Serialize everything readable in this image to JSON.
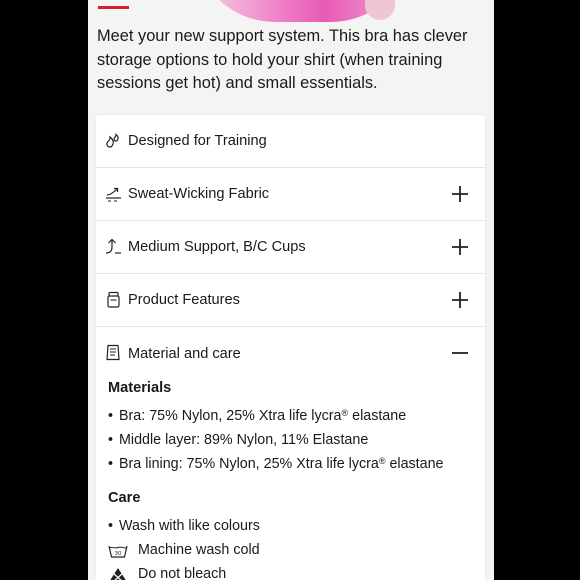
{
  "intro": "Meet your new support system. This bra has clever storage options to hold your shirt (when training sessions get hot) and small essentials.",
  "accordion": [
    {
      "label": "Designed for Training",
      "icon": "sparkle-drops-icon",
      "toggle": ""
    },
    {
      "label": "Sweat-Wicking Fabric",
      "icon": "wicking-icon",
      "toggle": "plus-icon"
    },
    {
      "label": "Medium Support, B/C Cups",
      "icon": "support-arrow-icon",
      "toggle": "plus-icon"
    },
    {
      "label": "Product Features",
      "icon": "layers-icon",
      "toggle": "plus-icon"
    },
    {
      "label": "Material and care",
      "icon": "care-label-icon",
      "toggle": "minus-icon"
    }
  ],
  "materials": {
    "heading": "Materials",
    "items": [
      {
        "text": "Bra: 75% Nylon, 25% Xtra life lycra",
        "sup": "®",
        "tail": " elastane"
      },
      {
        "text": "Middle layer: 89% Nylon, 11% Elastane",
        "sup": "",
        "tail": ""
      },
      {
        "text": "Bra lining: 75% Nylon, 25% Xtra life lycra",
        "sup": "®",
        "tail": " elastane"
      }
    ]
  },
  "care": {
    "heading": "Care",
    "bullet": "Wash with like colours",
    "instructions": [
      {
        "text": "Machine wash cold",
        "icon": "wash-30-icon"
      },
      {
        "text": "Do not bleach",
        "icon": "no-bleach-icon"
      }
    ]
  },
  "colors": {
    "accent": "#d6202f",
    "hero": "#e65bb6",
    "background": "#f4f4f4"
  }
}
